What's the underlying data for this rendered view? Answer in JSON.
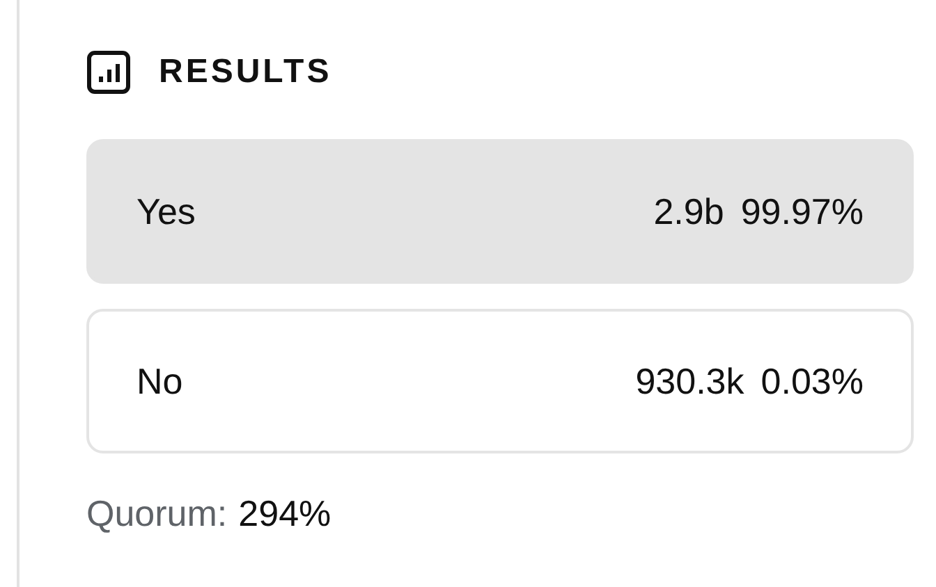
{
  "title": "RESULTS",
  "options": [
    {
      "label": "Yes",
      "votes": "2.9b",
      "percent": "99.97%",
      "selected": true
    },
    {
      "label": "No",
      "votes": "930.3k",
      "percent": "0.03%",
      "selected": false
    }
  ],
  "quorum": {
    "label": "Quorum:",
    "value": "294%"
  }
}
